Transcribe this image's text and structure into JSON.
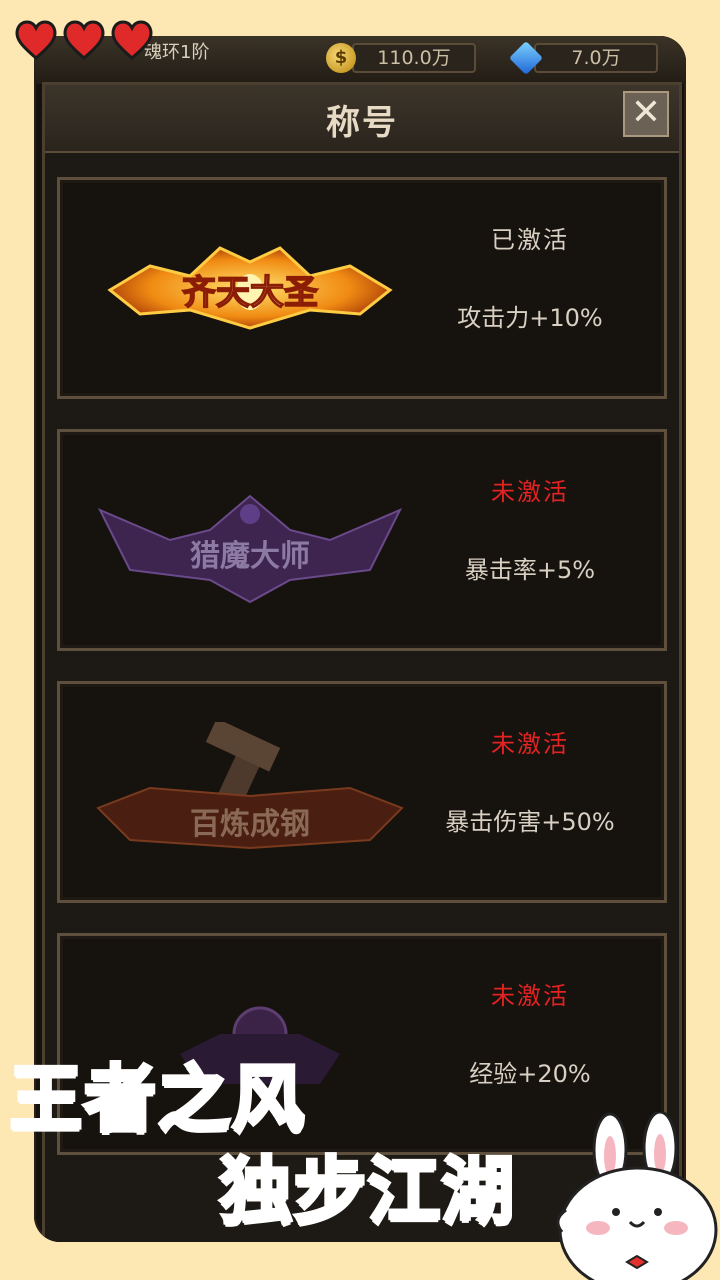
{
  "hud": {
    "level_text": "魂环1阶",
    "gold_amount": "110.0万",
    "gem_amount": "7.0万",
    "gold_icon": "gold-coin-icon",
    "gem_icon": "diamond-icon"
  },
  "dialog": {
    "title": "称号",
    "close_label": "✕"
  },
  "titles": [
    {
      "name": "齐天大圣",
      "status": "已激活",
      "bonus": "攻击力+10%",
      "active": true
    },
    {
      "name": "猎魔大师",
      "status": "未激活",
      "bonus": "暴击率+5%",
      "active": false
    },
    {
      "name": "百炼成钢",
      "status": "未激活",
      "bonus": "暴击伤害+50%",
      "active": false
    },
    {
      "name": "",
      "status": "未激活",
      "bonus": "经验+20%",
      "active": false
    }
  ],
  "promo": {
    "line1": "王者之风",
    "line2": "独步江湖"
  },
  "colors": {
    "background": "#fde7b3",
    "inactive_status": "#e32222",
    "slogan": "#f26a1b"
  }
}
